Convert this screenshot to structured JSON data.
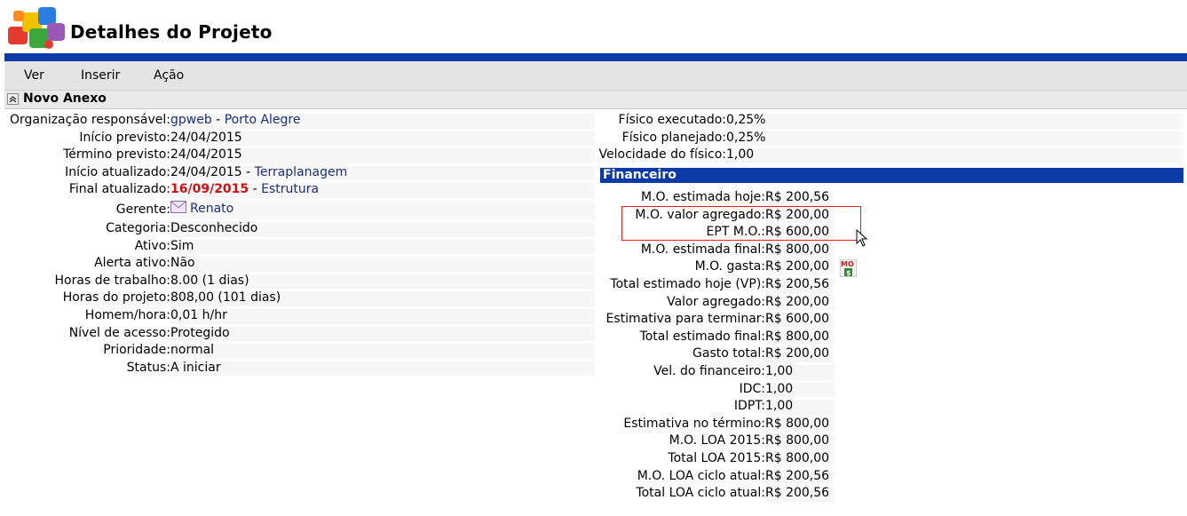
{
  "header": {
    "title": "Detalhes do Projeto"
  },
  "menu": {
    "items": [
      "Ver",
      "Inserir",
      "Ação"
    ]
  },
  "section": {
    "title": "Novo Anexo"
  },
  "left": {
    "organizacao": {
      "label": "Organização responsável:",
      "value": "gpweb",
      "sep": " - ",
      "value2": "Porto Alegre"
    },
    "inicio_previsto": {
      "label": "Início previsto:",
      "value": "24/04/2015"
    },
    "termino_previsto": {
      "label": "Término previsto:",
      "value": "24/04/2015"
    },
    "inicio_atualizado": {
      "label": "Início atualizado:",
      "value": "24/04/2015",
      "sep": " - ",
      "value2": "Terraplanagem"
    },
    "final_atualizado": {
      "label": "Final atualizado:",
      "value": "16/09/2015",
      "sep": " - ",
      "value2": "Estrutura"
    },
    "gerente": {
      "label": "Gerente:",
      "value": "Renato"
    },
    "categoria": {
      "label": "Categoria:",
      "value": "Desconhecido"
    },
    "ativo": {
      "label": "Ativo:",
      "value": "Sim"
    },
    "alerta_ativo": {
      "label": "Alerta ativo:",
      "value": "Não"
    },
    "horas_trabalho": {
      "label": "Horas de trabalho:",
      "value": "8.00 (1 dias)"
    },
    "horas_projeto": {
      "label": "Horas do projeto:",
      "value": "808,00 (101 dias)"
    },
    "homem_hora": {
      "label": "Homem/hora:",
      "value": "0,01 h/hr"
    },
    "nivel_acesso": {
      "label": "Nível de acesso:",
      "value": "Protegido"
    },
    "prioridade": {
      "label": "Prioridade:",
      "value": "normal"
    },
    "status": {
      "label": "Status:",
      "value": "A iniciar"
    }
  },
  "right_top": [
    {
      "label": "Físico executado:",
      "value": "0,25%"
    },
    {
      "label": "Físico planejado:",
      "value": "0,25%"
    },
    {
      "label": "Velocidade do físico:",
      "value": "1,00"
    }
  ],
  "financeiro": {
    "title": "Financeiro",
    "rows": [
      {
        "label": "M.O. estimada hoje:",
        "value": "R$ 200,56"
      },
      {
        "label": "M.O. valor agregado:",
        "value": "R$ 200,00"
      },
      {
        "label": "EPT M.O.:",
        "value": "R$ 600,00"
      },
      {
        "label": "M.O. estimada final:",
        "value": "R$ 800,00"
      },
      {
        "label": "M.O. gasta:",
        "value": "R$ 200,00"
      },
      {
        "label": "Total estimado hoje (VP):",
        "value": "R$ 200,56"
      },
      {
        "label": "Valor agregado:",
        "value": "R$ 200,00"
      },
      {
        "label": "Estimativa para terminar:",
        "value": "R$ 600,00"
      },
      {
        "label": "Total estimado final:",
        "value": "R$ 800,00"
      },
      {
        "label": "Gasto total:",
        "value": "R$ 200,00"
      },
      {
        "label": "Vel. do financeiro:",
        "value": "1,00"
      },
      {
        "label": "IDC:",
        "value": "1,00"
      },
      {
        "label": "IDPT:",
        "value": "1,00"
      },
      {
        "label": "Estimativa no término:",
        "value": "R$ 800,00"
      },
      {
        "label": "M.O. LOA 2015:",
        "value": "R$ 800,00"
      },
      {
        "label": "Total LOA 2015:",
        "value": "R$ 800,00"
      },
      {
        "label": "M.O. LOA ciclo atual:",
        "value": "R$ 200,56"
      },
      {
        "label": "Total LOA ciclo atual:",
        "value": "R$ 200,56"
      }
    ]
  },
  "icons": {
    "logo": "puzzle-logo-icon",
    "collapse": "double-chevron-up-icon",
    "gerente": "envelope-icon",
    "mo_gasta": "mo-report-icon",
    "cursor": "mouse-cursor-icon"
  },
  "colors": {
    "accent": "#0b3aa7",
    "highlight": "#cc1111",
    "link": "#1a2f7a"
  }
}
